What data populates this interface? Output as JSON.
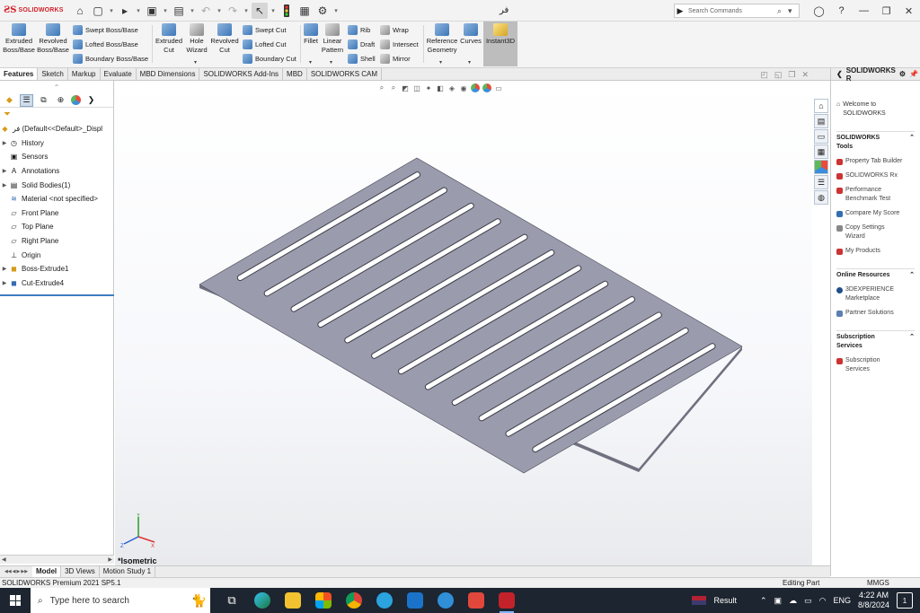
{
  "app": {
    "logo_text": "SOLIDWORKS",
    "doc_title": "فر"
  },
  "search": {
    "placeholder": "Search Commands"
  },
  "ribbon": {
    "extruded_boss": [
      "Extruded",
      "Boss/Base"
    ],
    "revolved_boss": [
      "Revolved",
      "Boss/Base"
    ],
    "swept_boss": "Swept Boss/Base",
    "lofted_boss": "Lofted Boss/Base",
    "boundary_boss": "Boundary Boss/Base",
    "extruded_cut": [
      "Extruded",
      "Cut"
    ],
    "hole_wizard": [
      "Hole",
      "Wizard"
    ],
    "revolved_cut": [
      "Revolved",
      "Cut"
    ],
    "swept_cut": "Swept Cut",
    "lofted_cut": "Lofted Cut",
    "boundary_cut": "Boundary Cut",
    "fillet": "Fillet",
    "linear_pattern": [
      "Linear",
      "Pattern"
    ],
    "rib": "Rib",
    "draft": "Draft",
    "shell": "Shell",
    "wrap": "Wrap",
    "intersect": "Intersect",
    "mirror": "Mirror",
    "reference_geometry": [
      "Reference",
      "Geometry"
    ],
    "curves": "Curves",
    "instant3d": "Instant3D"
  },
  "tabs": [
    "Features",
    "Sketch",
    "Markup",
    "Evaluate",
    "MBD Dimensions",
    "SOLIDWORKS Add-Ins",
    "MBD",
    "SOLIDWORKS CAM"
  ],
  "tree": {
    "root": "فر  (Default<<Default>_Displ",
    "items": [
      "History",
      "Sensors",
      "Annotations",
      "Solid Bodies(1)",
      "Material <not specified>",
      "Front Plane",
      "Top Plane",
      "Right Plane",
      "Origin",
      "Boss-Extrude1",
      "Cut-Extrude4"
    ]
  },
  "viewport": {
    "view_name": "*Isometric",
    "slot_count": 12,
    "plate_color": "#9a9cad"
  },
  "taskpane": {
    "title": "SOLIDWORKS R",
    "welcome": [
      "Welcome to",
      "SOLIDWORKS"
    ],
    "tools_title": [
      "SOLIDWORKS",
      "Tools"
    ],
    "tools": [
      [
        "Property Tab Builder"
      ],
      [
        "SOLIDWORKS Rx"
      ],
      [
        "Performance",
        "Benchmark Test"
      ],
      [
        "Compare My Score"
      ],
      [
        "Copy Settings",
        "Wizard"
      ],
      [
        "My Products"
      ]
    ],
    "online_title": "Online Resources",
    "online": [
      [
        "3DEXPERIENCE",
        "Marketplace"
      ],
      [
        "Partner Solutions"
      ]
    ],
    "sub_title": [
      "Subscription",
      "Services"
    ],
    "sub": [
      [
        "Subscription",
        "Services"
      ]
    ]
  },
  "bottom_tabs": [
    "Model",
    "3D Views",
    "Motion Study 1"
  ],
  "status": {
    "left": "SOLIDWORKS Premium 2021 SP5.1",
    "mode": "Editing Part",
    "units": "MMGS"
  },
  "taskbar": {
    "search_placeholder": "Type here to search",
    "weather": "Result",
    "lang": "ENG",
    "time": "4:22 AM",
    "date": "8/8/2024",
    "notifications": "1"
  }
}
